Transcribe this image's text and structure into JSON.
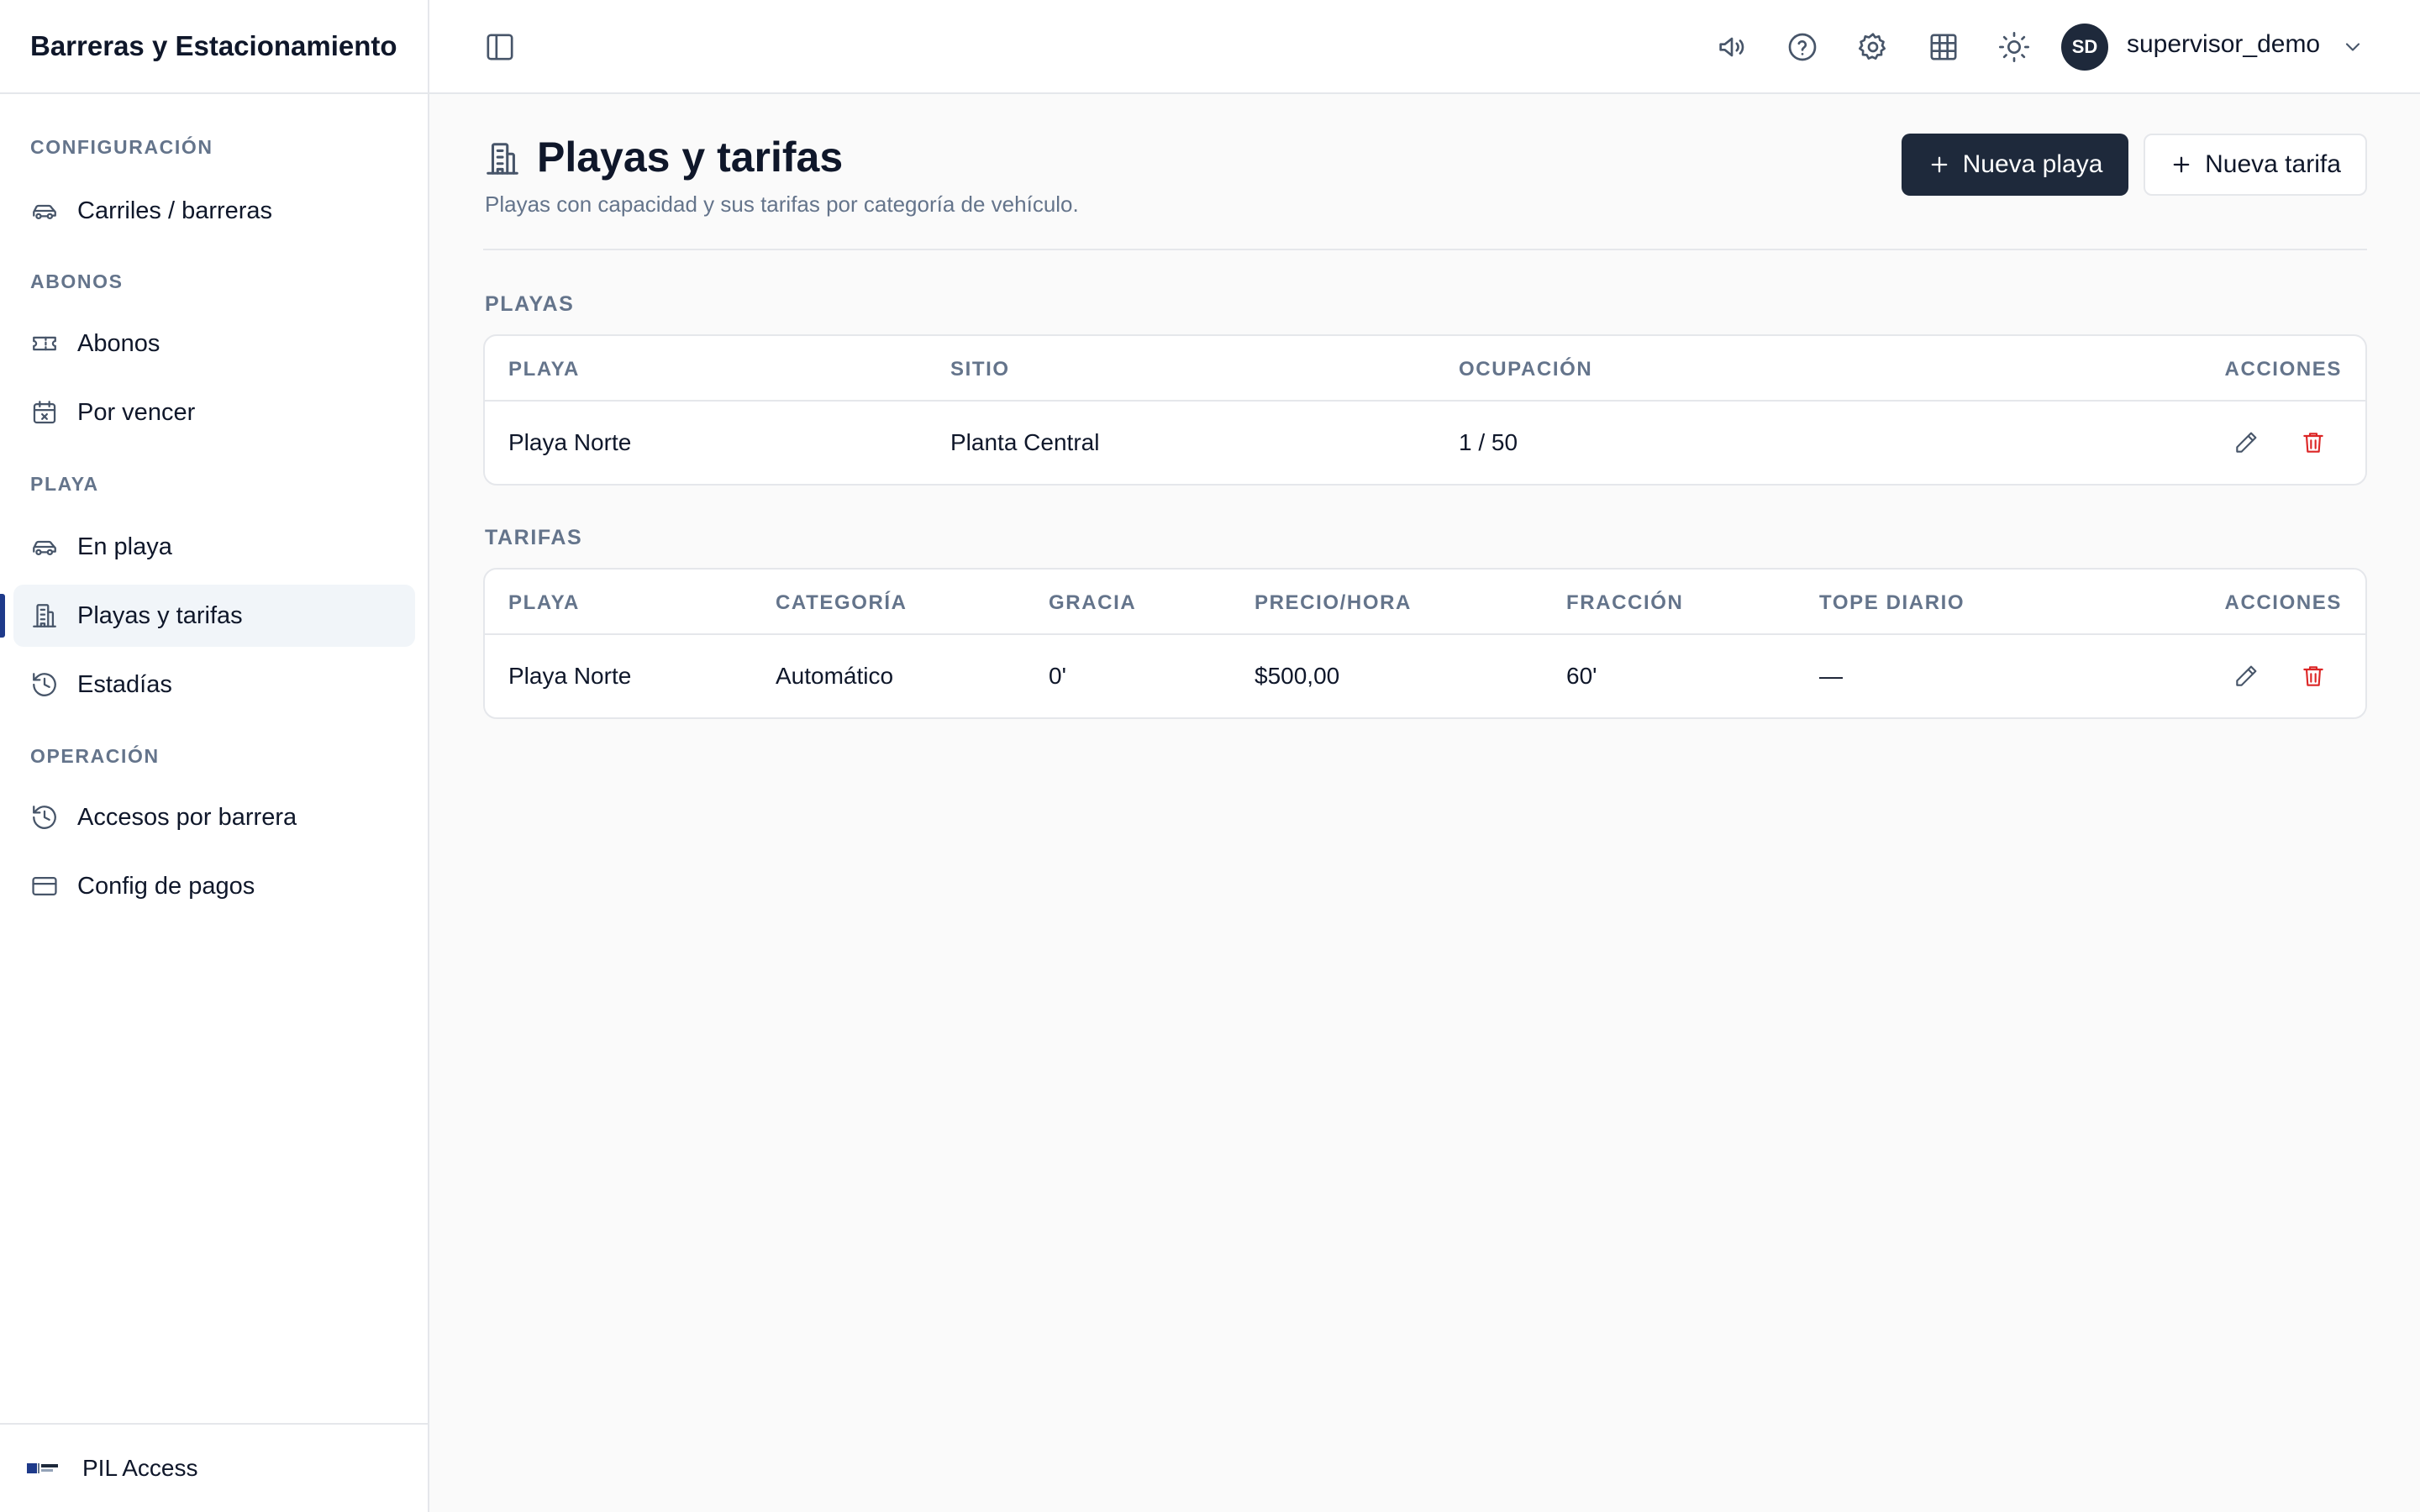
{
  "app": {
    "title": "Barreras y Estacionamiento",
    "footer_brand": "PIL Access"
  },
  "sidebar": {
    "sections": [
      {
        "title": "CONFIGURACIÓN",
        "items": [
          {
            "label": "Carriles / barreras",
            "icon": "car-icon"
          }
        ]
      },
      {
        "title": "ABONOS",
        "items": [
          {
            "label": "Abonos",
            "icon": "ticket-icon"
          },
          {
            "label": "Por vencer",
            "icon": "calendar-x-icon"
          }
        ]
      },
      {
        "title": "PLAYA",
        "items": [
          {
            "label": "En playa",
            "icon": "car-icon"
          },
          {
            "label": "Playas y tarifas",
            "icon": "building-icon",
            "active": true
          },
          {
            "label": "Estadías",
            "icon": "history-icon"
          }
        ]
      },
      {
        "title": "OPERACIÓN",
        "items": [
          {
            "label": "Accesos por barrera",
            "icon": "history-icon"
          },
          {
            "label": "Config de pagos",
            "icon": "credit-card-icon"
          }
        ]
      }
    ]
  },
  "topbar": {
    "icons": [
      "sidebar-toggle-icon",
      "megaphone-icon",
      "help-circle-icon",
      "gear-icon",
      "grid-icon",
      "sun-icon"
    ],
    "user": {
      "initials": "SD",
      "name": "supervisor_demo"
    }
  },
  "page": {
    "title": "Playas y tarifas",
    "subtitle": "Playas con capacidad y sus tarifas por categoría de vehículo.",
    "actions": {
      "new_lot": "Nueva playa",
      "new_rate": "Nueva tarifa"
    }
  },
  "lots": {
    "label": "PLAYAS",
    "columns": [
      "PLAYA",
      "SITIO",
      "OCUPACIÓN",
      "ACCIONES"
    ],
    "rows": [
      {
        "playa": "Playa Norte",
        "sitio": "Planta Central",
        "ocupacion": "1 / 50"
      }
    ]
  },
  "rates": {
    "label": "TARIFAS",
    "columns": [
      "PLAYA",
      "CATEGORÍA",
      "GRACIA",
      "PRECIO/HORA",
      "FRACCIÓN",
      "TOPE DIARIO",
      "ACCIONES"
    ],
    "rows": [
      {
        "playa": "Playa Norte",
        "categoria": "Automático",
        "gracia": "0'",
        "precio": "$500,00",
        "fraccion": "60'",
        "tope": "—"
      }
    ]
  },
  "colors": {
    "primary": "#1e293b",
    "danger": "#dc2626",
    "muted": "#64748b",
    "active_indicator": "#1e3a8a"
  }
}
